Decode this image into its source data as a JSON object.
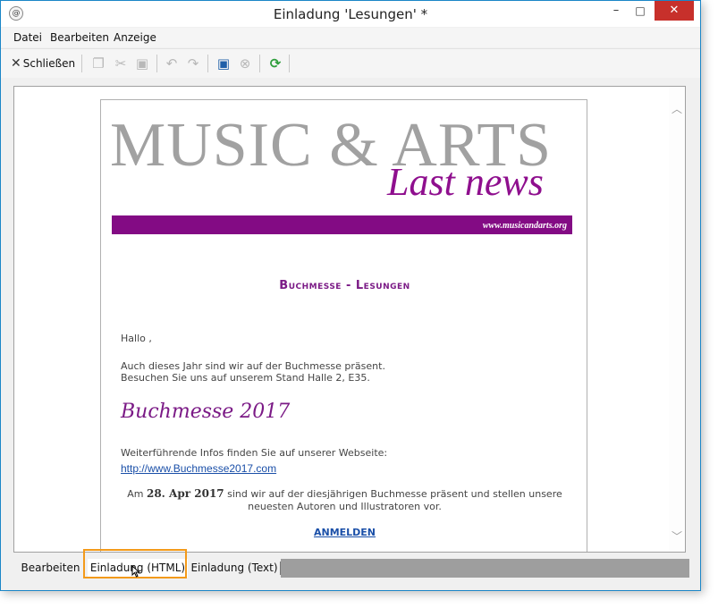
{
  "window": {
    "title": "Einladung 'Lesungen' *",
    "app_icon": "app-icon",
    "controls": {
      "minimize": "–",
      "maximize": "□",
      "close": "✕"
    }
  },
  "menubar": {
    "items": [
      "Datei",
      "Bearbeiten",
      "Anzeige"
    ]
  },
  "toolbar": {
    "close_label": "Schließen",
    "icons": [
      "copy-icon",
      "cut-icon",
      "paste-icon",
      "undo-icon",
      "redo-icon",
      "save-icon",
      "cancel-icon",
      "refresh-icon"
    ]
  },
  "newsletter": {
    "logo_main": "MUSIC & ARTS",
    "logo_script": "Last news",
    "website": "www.musicandarts.org",
    "headline": "Buchmesse - Lesungen",
    "greeting": "Hallo ,",
    "intro_line1": "Auch dieses Jahr sind wir auf der Buchmesse präsent.",
    "intro_line2": "Besuchen Sie uns auf unserem Stand Halle 2, E35.",
    "event_title": "Buchmesse 2017",
    "more_info": "Weiterführende Infos finden Sie auf unserer Webseite:",
    "link": "http://www.Buchmesse2017.com",
    "date_prefix": "Am",
    "date": "28. Apr 2017",
    "date_suffix": "sind wir auf der diesjährigen Buchmesse präsent und stellen unsere",
    "date_line2": "neuesten Autoren und Illustratoren vor.",
    "cta": "ANMELDEN"
  },
  "tabs": [
    {
      "label": "Bearbeiten",
      "active": false
    },
    {
      "label": "Einladung (HTML)",
      "active": true
    },
    {
      "label": "Einladung (Text)",
      "active": false
    }
  ],
  "colors": {
    "brand_purple": "#830b84",
    "headline_purple": "#7b1a86",
    "logo_gray": "#a1a1a1",
    "link_blue": "#1a4fa8",
    "highlight_orange": "#f39a1a",
    "close_red": "#c7302b"
  }
}
